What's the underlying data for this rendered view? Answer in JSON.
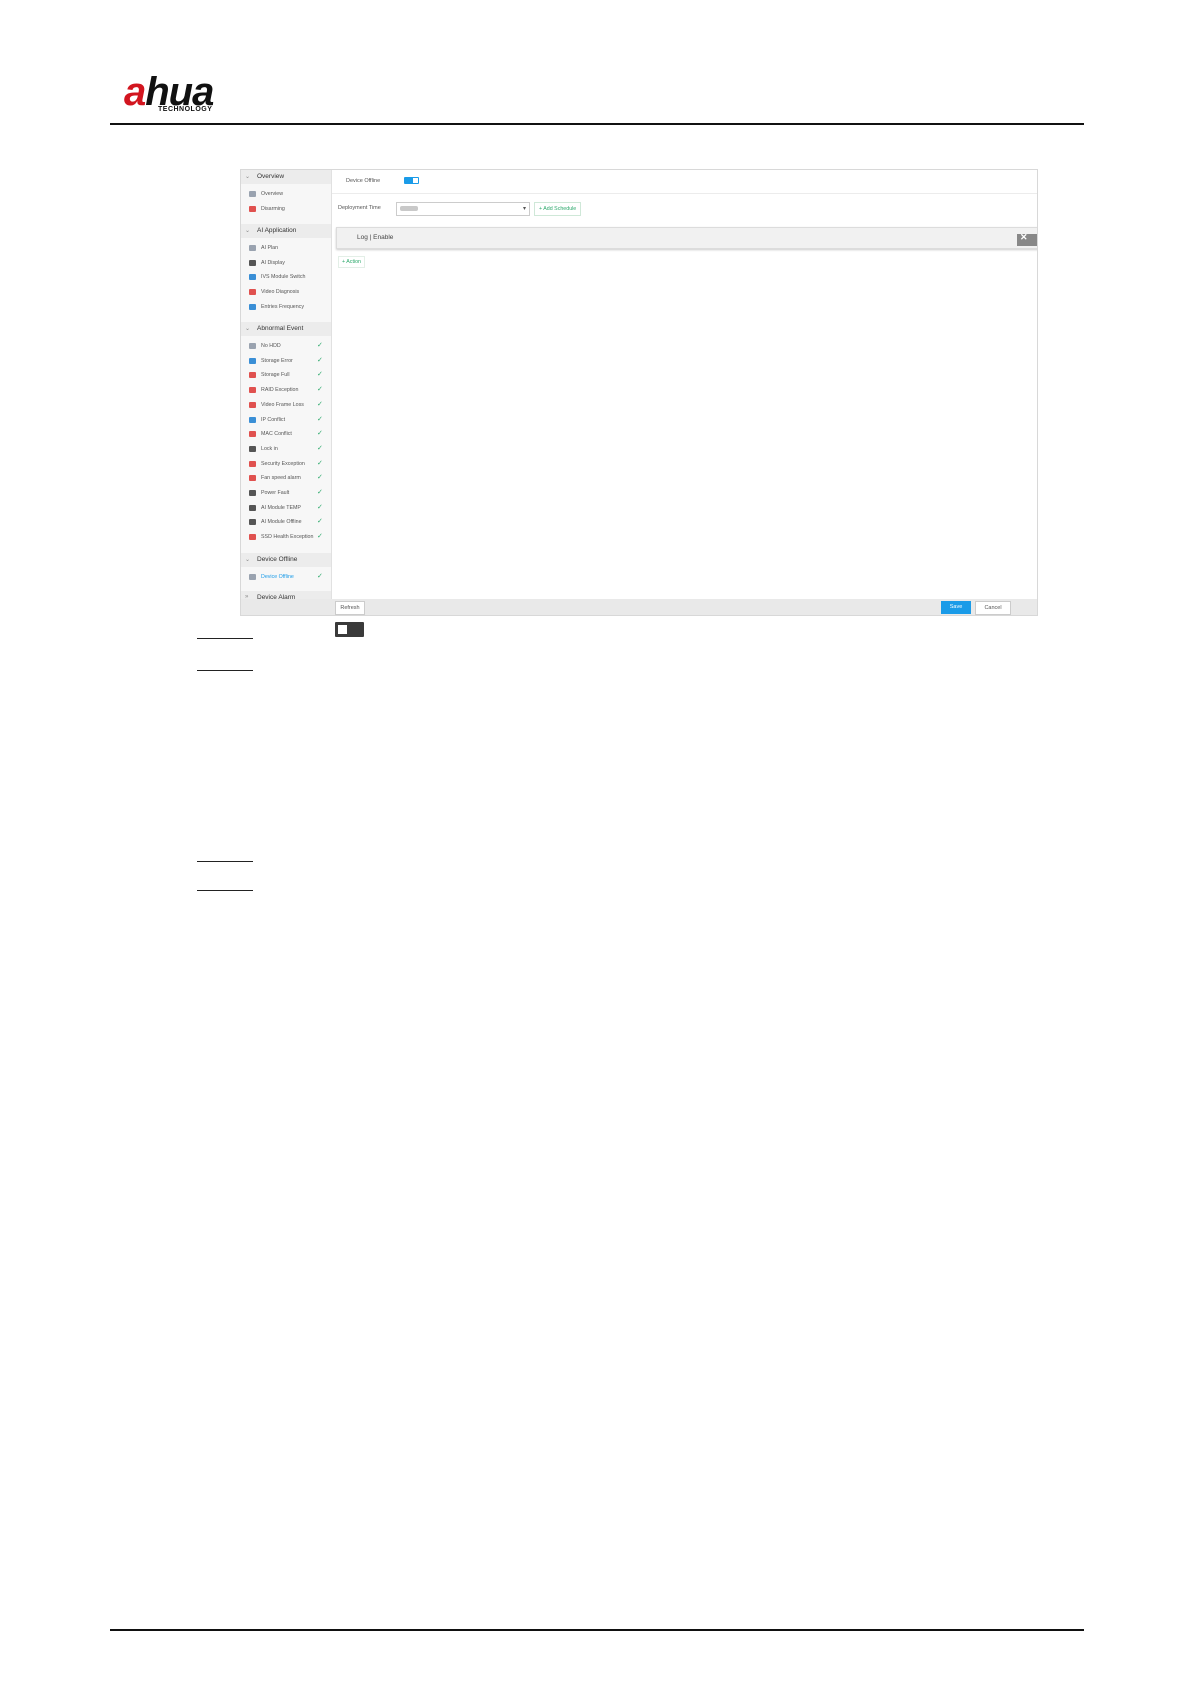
{
  "brand": {
    "logo_text_a": "a",
    "logo_text_rest": "hua",
    "logo_sub": "TECHNOLOGY"
  },
  "sidebar": {
    "sections": [
      {
        "label": "Overview"
      },
      {
        "label": "AI Application"
      },
      {
        "label": "Abnormal Event"
      },
      {
        "label": "Device Offline"
      },
      {
        "label": "Device Alarm"
      }
    ],
    "overview_items": [
      "Overview",
      "Disarming"
    ],
    "ai_items": [
      "AI Plan",
      "AI Display",
      "IVS Module Switch",
      "Video Diagnosis",
      "Entries Frequency"
    ],
    "abnormal_items": [
      "No HDD",
      "Storage Error",
      "Storage Full",
      "RAID Exception",
      "Video Frame Loss",
      "IP Conflict",
      "MAC Conflict",
      "Lock in",
      "Security Exception",
      "Fan speed alarm",
      "Power Fault",
      "AI Module TEMP",
      "AI Module Offline",
      "SSD Health Exception"
    ],
    "device_offline_item": "Device Offline",
    "check_glyph": "✓"
  },
  "main": {
    "device_offline_label": "Device Offline",
    "deployment_time_label": "Deployment Time",
    "add_schedule_label": "+ Add Schedule",
    "log_label": "Log | Enable",
    "action_label": "+ Action",
    "close_glyph": "✕"
  },
  "footer": {
    "refresh_label": "Refresh",
    "save_label": "Save",
    "cancel_label": "Cancel"
  },
  "colors": {
    "accent": "#1a9be8",
    "check": "#2aa86a",
    "brand_red": "#d2151f"
  }
}
